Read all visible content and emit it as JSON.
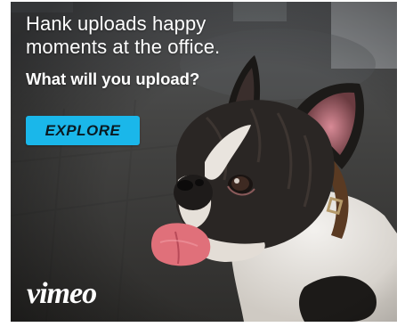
{
  "ad": {
    "headline_line1": "Hank uploads happy",
    "headline_line2": "moments at the office.",
    "tagline": "What will you upload?",
    "cta_label": "EXPLORE",
    "brand": "vimeo"
  },
  "colors": {
    "cta_background": "#1ab7ea",
    "text": "#ffffff"
  }
}
